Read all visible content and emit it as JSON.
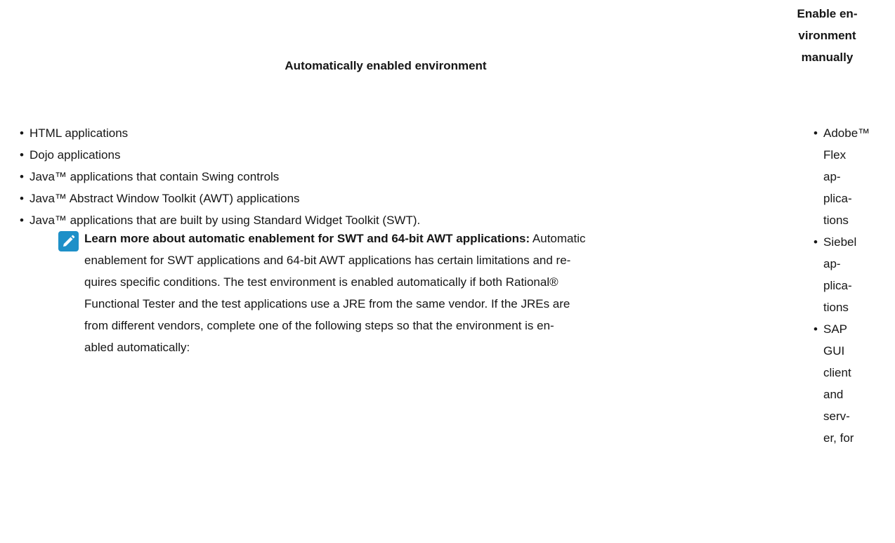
{
  "table": {
    "header_auto": "Automatically enabled environment",
    "header_manual_lines": [
      "Enable en-",
      "vironment",
      "manually"
    ]
  },
  "auto_list": [
    "HTML applications",
    "Dojo applications",
    "Java™ applications that contain Swing controls",
    "Java™ Abstract Window Toolkit (AWT) applications",
    "Java™ applications that are built by using Standard Widget Toolkit (SWT)."
  ],
  "note": {
    "icon": "pencil-icon",
    "icon_color": "#1e90c8",
    "title": "Learn more about automatic enablement for SWT and 64-bit AWT applications:",
    "lines": [
      "Automatic",
      "enablement for SWT applications and 64-bit AWT applications has certain limitations and re-",
      "quires specific conditions. The test environment is enabled automatically if both Rational®",
      "Functional Tester and the test applications use a JRE from the same vendor. If the JREs are",
      "from different vendors, complete one of the following steps so that the environment is en-",
      "abled automatically:"
    ]
  },
  "manual_list": [
    {
      "lines": [
        "Adobe™",
        "Flex",
        "ap-",
        "plica-",
        "tions"
      ]
    },
    {
      "lines": [
        "Siebel",
        "ap-",
        "plica-",
        "tions"
      ]
    },
    {
      "lines": [
        "SAP",
        "GUI",
        "client",
        "and",
        "serv-",
        "er, for"
      ]
    }
  ]
}
